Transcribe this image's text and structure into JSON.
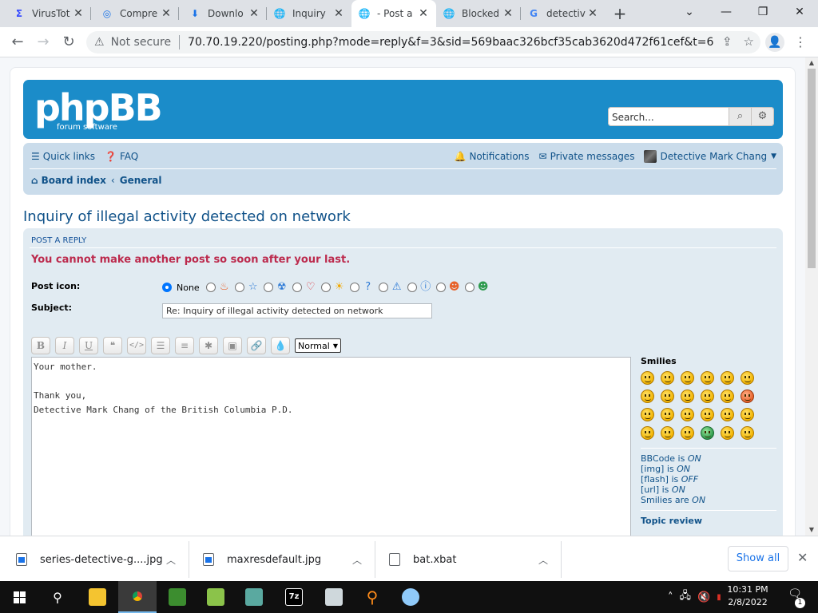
{
  "browser": {
    "tabs": [
      {
        "title": "VirusTot",
        "icon": "virustotal-icon",
        "active": false
      },
      {
        "title": "Compre",
        "icon": "compress-icon",
        "active": false
      },
      {
        "title": "Downlo",
        "icon": "download-icon",
        "active": false
      },
      {
        "title": "Inquiry",
        "icon": "globe-icon",
        "active": false
      },
      {
        "title": "- Post a",
        "icon": "globe-icon",
        "active": true
      },
      {
        "title": "Blocked",
        "icon": "globe-icon",
        "active": false
      },
      {
        "title": "detectiv",
        "icon": "google-icon",
        "active": false
      }
    ],
    "security_label": "Not secure",
    "url": "70.70.19.220/posting.php?mode=reply&f=3&sid=569baac326bcf35cab3620d472f61cef&t=6"
  },
  "forum": {
    "logo_text": "phpBB",
    "logo_subtext": "forum software",
    "search_placeholder": "Search...",
    "nav": {
      "quick_links": "Quick links",
      "faq": "FAQ",
      "notifications": "Notifications",
      "private_messages": "Private messages",
      "username": "Detective Mark Chang",
      "board_index": "Board index",
      "breadcrumb_sep": "‹",
      "forum_name": "General"
    },
    "topic_title": "Inquiry of illegal activity detected on network",
    "panel_heading": "POST A REPLY",
    "error_message": "You cannot make another post so soon after your last.",
    "post_icon_label": "Post icon:",
    "post_icon_none": "None",
    "subject_label": "Subject:",
    "subject_value": "Re: Inquiry of illegal activity detected on network",
    "toolbar": {
      "bold": "B",
      "italic": "I",
      "underline": "U",
      "font_size_selected": "Normal"
    },
    "message_lines": [
      "Your mother.",
      "",
      "Thank you,",
      "Detective Mark Chang of the British Columbia P.D."
    ],
    "smilies_heading": "Smilies",
    "bbcode_status": [
      {
        "label": "BBCode is ",
        "state": "ON"
      },
      {
        "label": "[img] is ",
        "state": "ON"
      },
      {
        "label": "[flash] is ",
        "state": "OFF"
      },
      {
        "label": "[url] is ",
        "state": "ON"
      },
      {
        "label": "Smilies are ",
        "state": "ON"
      }
    ],
    "topic_review": "Topic review"
  },
  "downloads": {
    "items": [
      {
        "name": "series-detective-g....jpg",
        "type": "image"
      },
      {
        "name": "maxresdefault.jpg",
        "type": "image"
      },
      {
        "name": "bat.xbat",
        "type": "file"
      }
    ],
    "show_all": "Show all"
  },
  "taskbar": {
    "time": "10:31 PM",
    "date": "2/8/2022",
    "notification_count": "1"
  },
  "colors": {
    "phpbb_header": "#1b8cc9",
    "navbar_bg": "#cadceb",
    "panel_bg": "#e1ebf2",
    "link": "#105289",
    "error": "#bc2a4d"
  }
}
